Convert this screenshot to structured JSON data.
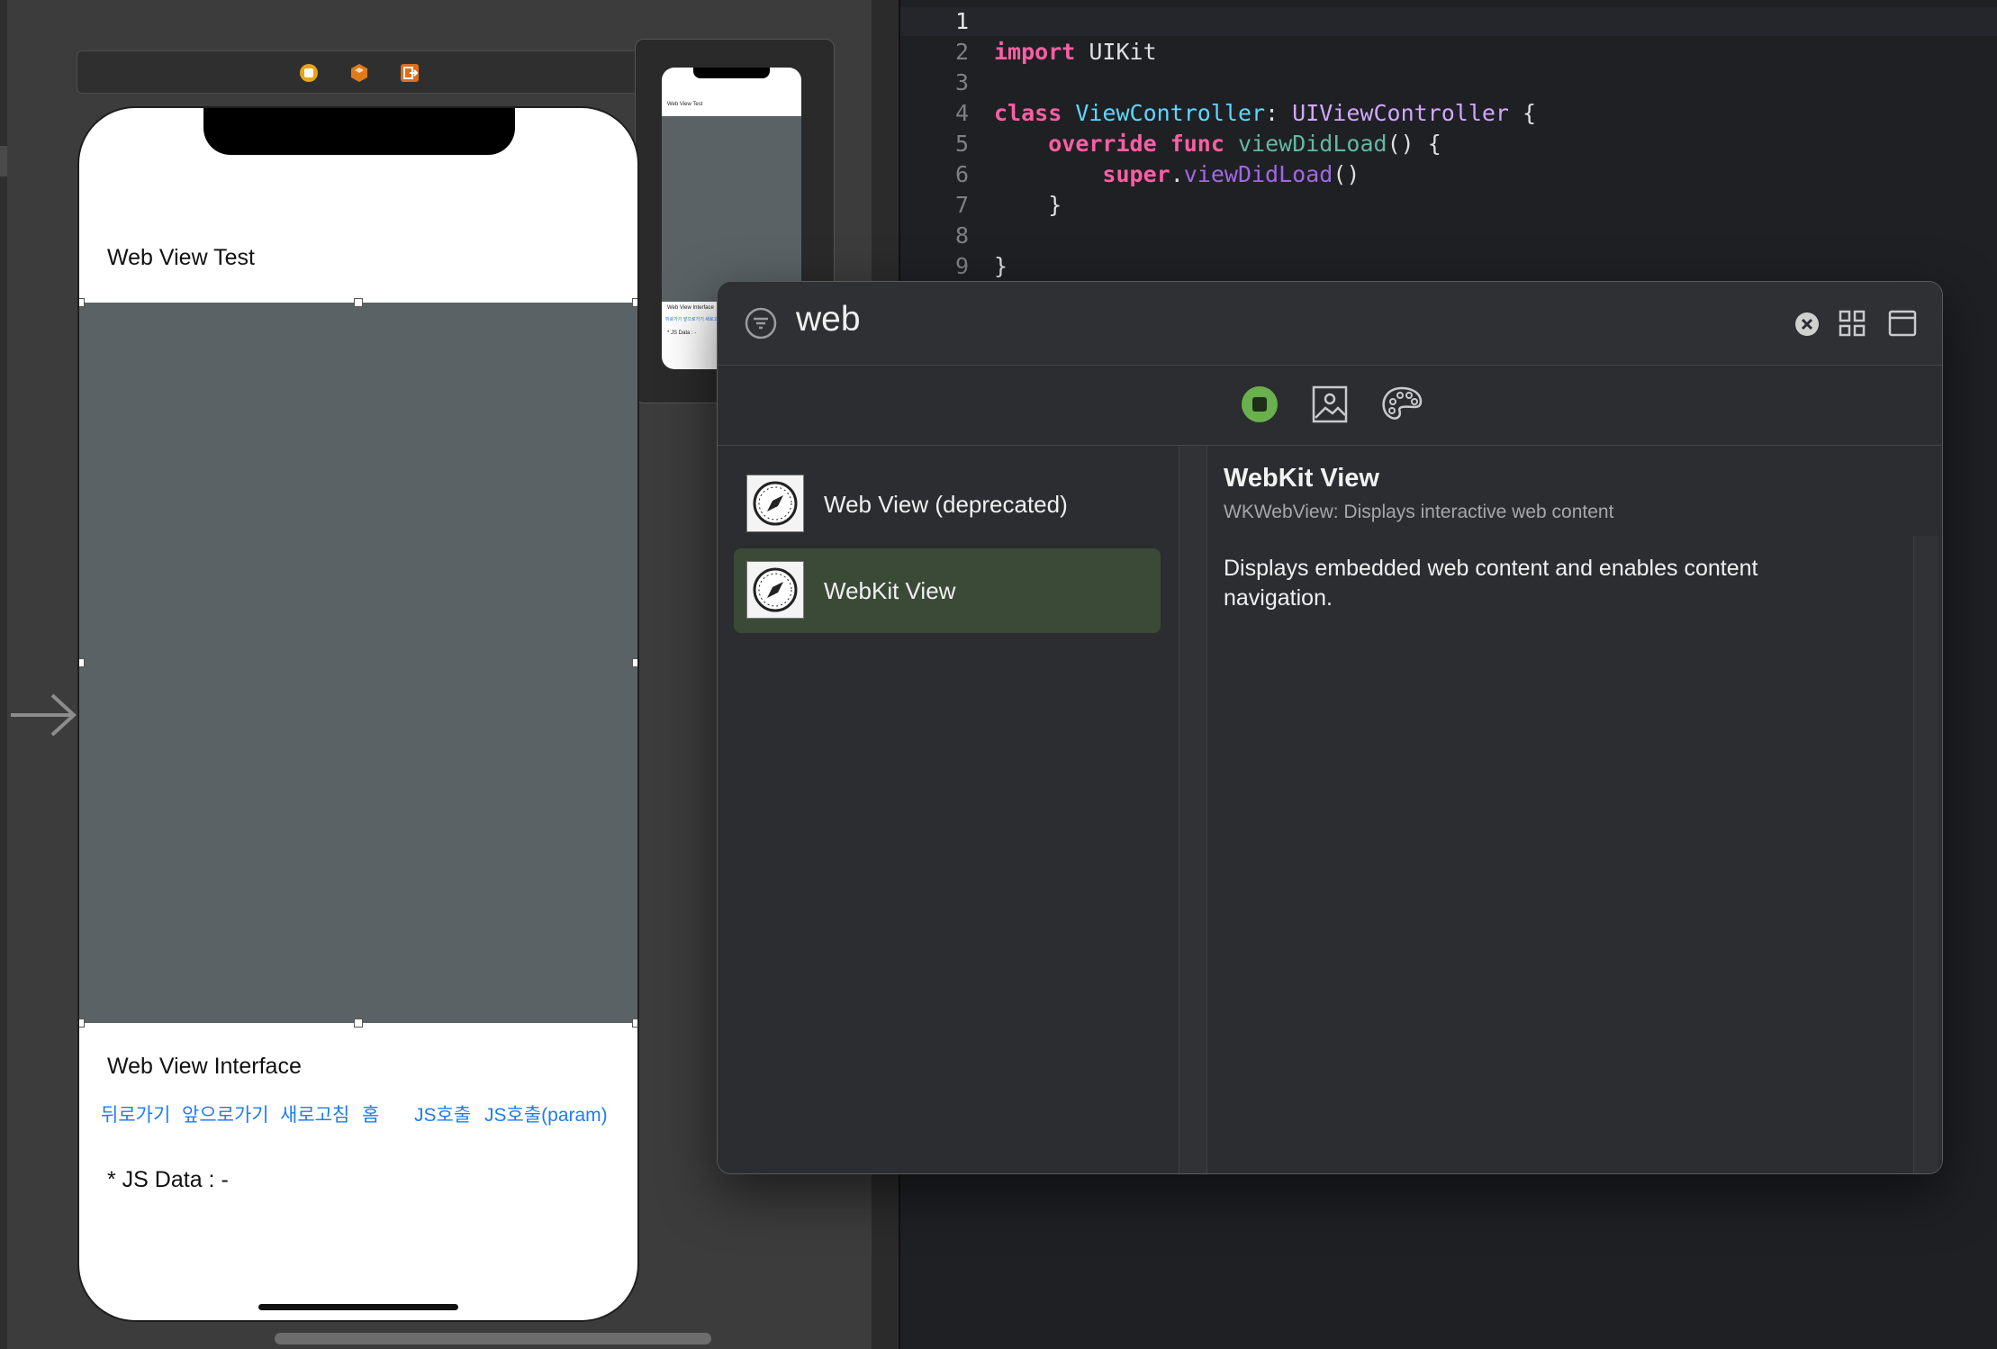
{
  "storyboard": {
    "scene_bar_icons": [
      "view-controller-icon",
      "first-responder-icon",
      "exit-icon"
    ],
    "phone": {
      "title_label": "Web View Test",
      "interface_label": "Web View Interface",
      "buttons": [
        "뒤로가기",
        "앞으로가기",
        "새로고침",
        "홈",
        "JS호출",
        "JS호출(param)"
      ],
      "js_data": "* JS Data : -"
    },
    "preview": {
      "title_label": "Web View Test",
      "interface_label": "Web View Interface",
      "buttons_line": "뒤로가기 앞으로가기 새로고침 홈 JS호출 JS호출(param)",
      "js_data": "* JS Data : -"
    }
  },
  "editor": {
    "lines": [
      {
        "num": "1",
        "tokens": []
      },
      {
        "num": "2",
        "tokens": [
          {
            "t": "import",
            "c": "kw"
          },
          {
            "t": " UIKit",
            "c": ""
          }
        ]
      },
      {
        "num": "3",
        "tokens": []
      },
      {
        "num": "4",
        "tokens": [
          {
            "t": "class",
            "c": "kw"
          },
          {
            "t": " ",
            "c": ""
          },
          {
            "t": "ViewController",
            "c": "type"
          },
          {
            "t": ": ",
            "c": ""
          },
          {
            "t": "UIViewController",
            "c": "type2"
          },
          {
            "t": " {",
            "c": ""
          }
        ]
      },
      {
        "num": "5",
        "tokens": [
          {
            "t": "    ",
            "c": ""
          },
          {
            "t": "override",
            "c": "kw"
          },
          {
            "t": " ",
            "c": ""
          },
          {
            "t": "func",
            "c": "kw"
          },
          {
            "t": " ",
            "c": ""
          },
          {
            "t": "viewDidLoad",
            "c": "fn"
          },
          {
            "t": "() {",
            "c": ""
          }
        ]
      },
      {
        "num": "6",
        "tokens": [
          {
            "t": "        ",
            "c": ""
          },
          {
            "t": "super",
            "c": "kw"
          },
          {
            "t": ".",
            "c": ""
          },
          {
            "t": "viewDidLoad",
            "c": "fn2"
          },
          {
            "t": "()",
            "c": ""
          }
        ]
      },
      {
        "num": "7",
        "tokens": [
          {
            "t": "    }",
            "c": ""
          }
        ]
      },
      {
        "num": "8",
        "tokens": []
      },
      {
        "num": "9",
        "tokens": [
          {
            "t": "}",
            "c": ""
          }
        ]
      }
    ]
  },
  "library": {
    "search_value": "web",
    "tabs": [
      "objects-tab-icon",
      "media-tab-icon",
      "colors-tab-icon"
    ],
    "items": [
      {
        "label": "Web View (deprecated)",
        "selected": false
      },
      {
        "label": "WebKit View",
        "selected": true
      }
    ],
    "detail": {
      "title": "WebKit View",
      "subtitle": "WKWebView: Displays interactive web content",
      "description": "Displays embedded web content and enables content navigation."
    },
    "colors": {
      "accent_green": "#6ab04c",
      "selected_row": "#3b4a37"
    }
  }
}
